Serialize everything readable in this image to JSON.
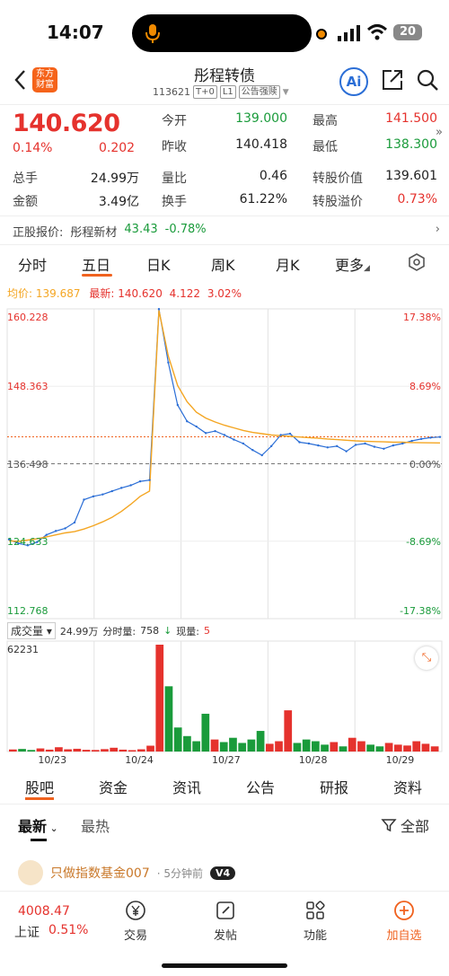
{
  "status_bar": {
    "time": "14:07",
    "battery": "20"
  },
  "header": {
    "title": "彤程转债",
    "code": "113621",
    "tags": [
      "T+0",
      "L1",
      "公告强赎"
    ],
    "logo_line1": "东方",
    "logo_line2": "财富",
    "ai_label": "Ai"
  },
  "quote": {
    "price": "140.620",
    "change_pct": "0.14%",
    "change_val": "0.202",
    "fields": [
      {
        "label": "今开",
        "value": "139.000",
        "color": "#1a9b3b"
      },
      {
        "label": "最高",
        "value": "141.500",
        "color": "#e5322d"
      },
      {
        "label": "昨收",
        "value": "140.418",
        "color": "#222222"
      },
      {
        "label": "最低",
        "value": "138.300",
        "color": "#1a9b3b"
      },
      {
        "label": "总手",
        "value": "24.99万",
        "color": "#222222"
      },
      {
        "label": "量比",
        "value": "0.46",
        "color": "#222222"
      },
      {
        "label": "转股价值",
        "value": "139.601",
        "color": "#222222"
      },
      {
        "label": "金额",
        "value": "3.49亿",
        "color": "#222222"
      },
      {
        "label": "换手",
        "value": "61.22%",
        "color": "#222222"
      },
      {
        "label": "转股溢价",
        "value": "0.73%",
        "color": "#e5322d"
      }
    ],
    "underlying_label": "正股报价:",
    "underlying_name": "彤程新材",
    "underlying_price": "43.43",
    "underlying_pct": "-0.78%"
  },
  "period_tabs": [
    "分时",
    "五日",
    "日K",
    "周K",
    "月K",
    "更多"
  ],
  "chart_legend": {
    "avg_label": "均价:",
    "avg_value": "139.687",
    "latest_label": "最新:",
    "latest_value": "140.620",
    "latest_change": "4.122",
    "latest_pct": "3.02%"
  },
  "chart_data": {
    "type": "line",
    "price_axis_labels": [
      "160.228",
      "148.363",
      "136.498",
      "124.633",
      "112.768"
    ],
    "pct_axis_labels": [
      "17.38%",
      "8.69%",
      "0.00%",
      "-8.69%",
      "-17.38%"
    ],
    "x_labels": [
      "10/23",
      "10/24",
      "10/27",
      "10/28",
      "10/29"
    ],
    "ylim": [
      112.768,
      160.228
    ],
    "reference_price": 136.498,
    "current_price": 140.62,
    "series": [
      {
        "name": "price",
        "values": [
          124.9,
          124.3,
          124.0,
          124.5,
          125.6,
          126.2,
          126.6,
          127.5,
          131.0,
          131.5,
          131.8,
          132.3,
          132.8,
          133.2,
          133.8,
          134.0,
          160.2,
          152.0,
          145.5,
          143.0,
          142.2,
          141.2,
          141.5,
          140.9,
          140.2,
          139.6,
          138.6,
          137.8,
          139.2,
          140.9,
          141.1,
          139.8,
          139.6,
          139.3,
          139.0,
          139.2,
          138.4,
          139.4,
          139.6,
          139.1,
          138.8,
          139.3,
          139.6,
          140.0,
          140.3,
          140.5,
          140.6
        ]
      },
      {
        "name": "avg",
        "values": [
          124.7,
          124.6,
          124.8,
          125.0,
          125.3,
          125.6,
          125.9,
          126.1,
          126.5,
          127.0,
          127.6,
          128.3,
          129.2,
          130.3,
          131.5,
          132.3,
          160.0,
          153.0,
          148.5,
          146.0,
          144.4,
          143.5,
          142.9,
          142.4,
          142.0,
          141.6,
          141.3,
          141.1,
          140.9,
          140.8,
          140.7,
          140.6,
          140.5,
          140.4,
          140.3,
          140.2,
          140.1,
          140.0,
          139.95,
          139.9,
          139.85,
          139.8,
          139.8,
          139.75,
          139.72,
          139.7,
          139.687
        ]
      }
    ],
    "volume": {
      "max_label": "62231",
      "values": [
        1200,
        1500,
        900,
        1800,
        1100,
        2500,
        1300,
        1600,
        1000,
        900,
        1400,
        2200,
        1100,
        800,
        1300,
        3400,
        62231,
        38000,
        14000,
        9000,
        6000,
        22000,
        7000,
        5500,
        8000,
        5000,
        7000,
        12000,
        4500,
        6000,
        24000,
        5000,
        7000,
        6000,
        4000,
        5500,
        3000,
        8000,
        6000,
        4000,
        3000,
        5000,
        4000,
        3500,
        6000,
        4500,
        3000
      ]
    }
  },
  "volume_bar": {
    "select_label": "成交量",
    "total": "24.99万",
    "split_label": "分时量:",
    "split_value": "758",
    "now_label": "现量:",
    "now_value": "5"
  },
  "bottom_tabs": [
    "股吧",
    "资金",
    "资讯",
    "公告",
    "研报",
    "资料"
  ],
  "feed": {
    "sort_new": "最新",
    "sort_hot": "最热",
    "filter_label": "全部",
    "author": "只做指数基金007",
    "post_time": "5分钟前",
    "level": "V4"
  },
  "bottom_nav": {
    "index_value": "4008.47",
    "index_name": "上证",
    "index_pct": "0.51%",
    "items": [
      "交易",
      "发帖",
      "功能",
      "加自选"
    ]
  },
  "colors": {
    "up": "#e5322d",
    "down": "#1a9b3b",
    "accent": "#f0621f",
    "price_line": "#2b6ed6",
    "avg_line": "#f4a623"
  }
}
